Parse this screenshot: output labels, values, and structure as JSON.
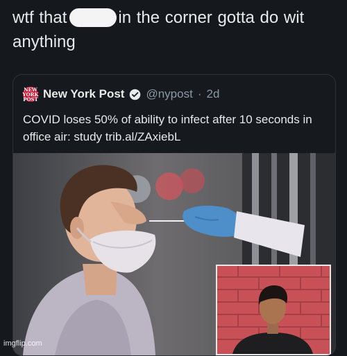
{
  "reply": {
    "text_before_blur": "wtf that",
    "text_after_blur": "in the corner gotta do wit anything"
  },
  "embedded_tweet": {
    "author_name": "New York Post",
    "logo_label": "NEW YORK POST",
    "handle": "@nypost",
    "separator": "·",
    "age": "2d",
    "text": "COVID loses 50% of ability to infect after 10 seconds in office air: study trib.al/ZAxiebL"
  },
  "watermark": "imgflip.com",
  "colors": {
    "background": "#15181c",
    "text": "#e7e9ea",
    "muted": "#8b98a5",
    "verified": "#1d9bf0",
    "nyp_red": "#c8102e"
  }
}
